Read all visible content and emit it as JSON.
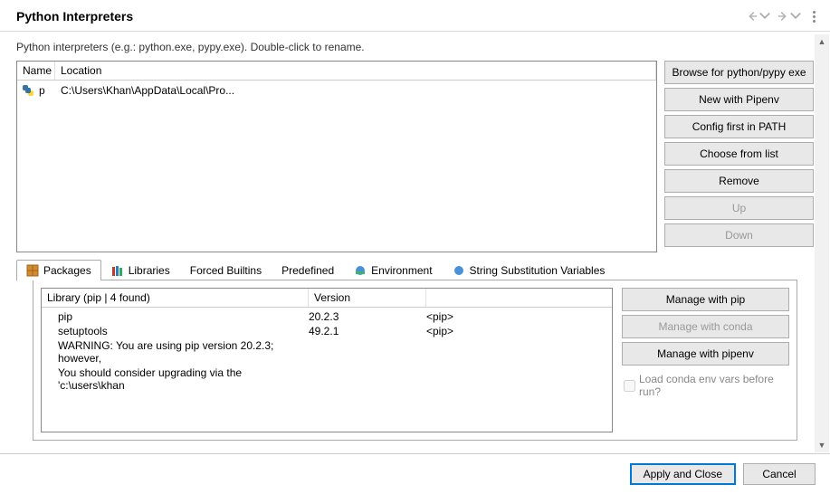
{
  "header": {
    "title": "Python Interpreters"
  },
  "subtitle": "Python interpreters (e.g.: python.exe, pypy.exe).   Double-click to rename.",
  "interpreters": {
    "columns": {
      "name": "Name",
      "location": "Location"
    },
    "rows": [
      {
        "name": "p",
        "location": "C:\\Users\\Khan\\AppData\\Local\\Pro..."
      }
    ]
  },
  "side_buttons": {
    "browse": "Browse for python/pypy exe",
    "pipenv": "New with Pipenv",
    "config": "Config first in PATH",
    "choose": "Choose from list",
    "remove": "Remove",
    "up": "Up",
    "down": "Down"
  },
  "tabs": {
    "packages": "Packages",
    "libraries": "Libraries",
    "forced": "Forced Builtins",
    "predefined": "Predefined",
    "environment": "Environment",
    "substitution": "String Substitution Variables"
  },
  "packages": {
    "header": "Library (pip | 4 found)",
    "version_header": "Version",
    "rows": [
      {
        "lib": "pip",
        "ver": "20.2.3",
        "src": "<pip>"
      },
      {
        "lib": "setuptools",
        "ver": "49.2.1",
        "src": "<pip>"
      },
      {
        "lib": "WARNING: You are using pip version 20.2.3; however,",
        "ver": "",
        "src": ""
      },
      {
        "lib": "You should consider upgrading via the 'c:\\users\\khan",
        "ver": "",
        "src": ""
      }
    ]
  },
  "side_buttons2": {
    "pip": "Manage with pip",
    "conda": "Manage with conda",
    "pipenv": "Manage with pipenv",
    "load_conda": "Load conda env vars before run?"
  },
  "bottom": {
    "apply": "Apply and Close",
    "cancel": "Cancel"
  }
}
